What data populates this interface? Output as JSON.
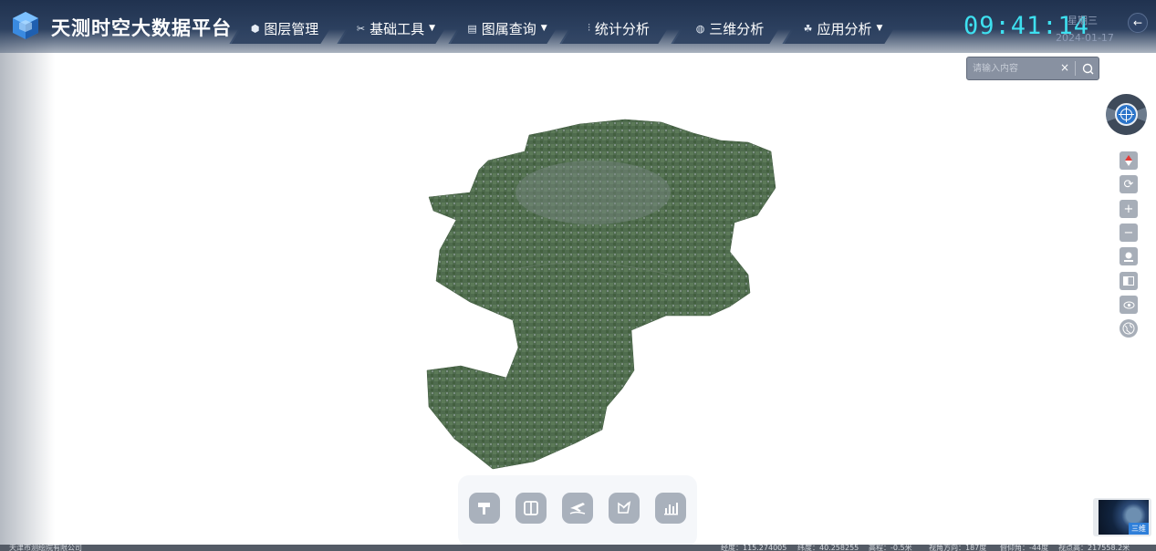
{
  "header": {
    "title": "天测时空大数据平台",
    "nav": [
      {
        "label": "图层管理",
        "icon": "layers-icon",
        "dropdown": false
      },
      {
        "label": "基础工具",
        "icon": "tools-icon",
        "dropdown": true
      },
      {
        "label": "图属查询",
        "icon": "query-icon",
        "dropdown": true
      },
      {
        "label": "统计分析",
        "icon": "statistics-icon",
        "dropdown": false
      },
      {
        "label": "三维分析",
        "icon": "3d-analysis-icon",
        "dropdown": false
      },
      {
        "label": "应用分析",
        "icon": "application-icon",
        "dropdown": true
      }
    ],
    "clock": "09:41:14",
    "weekday": "星期三",
    "date": "2024-01-17"
  },
  "search": {
    "placeholder": "请输入内容",
    "clear_label": "×"
  },
  "side_tools": [
    "north-arrow-icon",
    "refresh-icon",
    "zoom-in-icon",
    "zoom-out-icon",
    "location-icon",
    "split-screen-icon",
    "visibility-icon",
    "globe-icon"
  ],
  "bottom_tools": [
    "measure-icon",
    "compare-icon",
    "flight-icon",
    "draw-icon",
    "chart-icon"
  ],
  "mini_map": {
    "label": "三维"
  },
  "status": {
    "company": "天津市测绘院有限公司",
    "lon": "经度：115.274005",
    "lat": "纬度：40.258255",
    "scale": "高程：-0.5米",
    "heading": "视角方向：187度",
    "pitch": "俯仰角：-44度",
    "height": "视点高：217558.2米"
  },
  "colors": {
    "header": "#2c405f",
    "clock": "#3ee0f0",
    "tool": "#a7aeb8",
    "map": "#4d6a4f"
  }
}
